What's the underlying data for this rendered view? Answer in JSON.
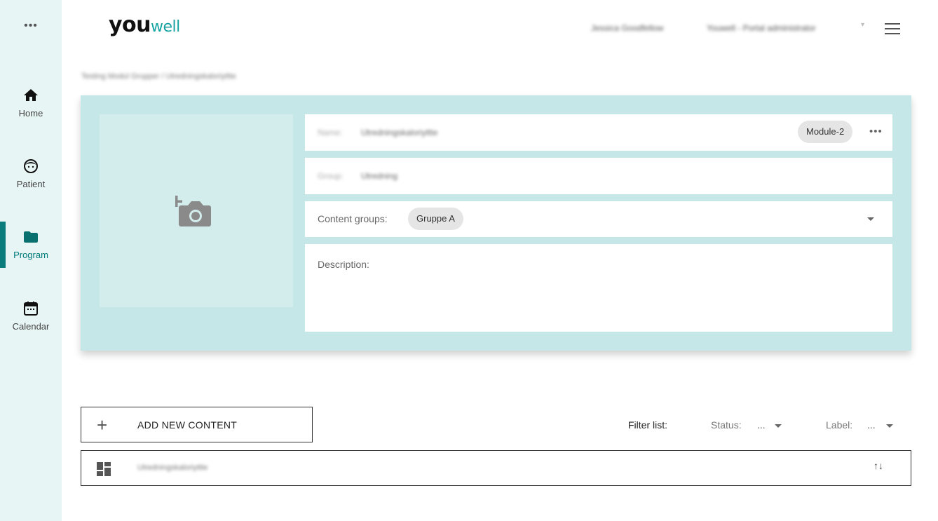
{
  "sidebar": {
    "more_label": "•••",
    "items": [
      {
        "label": "Home",
        "icon": "home-icon"
      },
      {
        "label": "Patient",
        "icon": "face-icon"
      },
      {
        "label": "Program",
        "icon": "folder-icon",
        "active": true
      },
      {
        "label": "Calendar",
        "icon": "calendar-icon"
      }
    ]
  },
  "header": {
    "logo_prefix": "you",
    "logo_suffix": "well",
    "user_name": "Jessica Goodfellow",
    "user_role": "Youwell - Portal administrator",
    "role_caret": "▾",
    "menu_icon": "hamburger-icon"
  },
  "breadcrumb": "Testing Modul Grupper / Utredningskaloriyttte",
  "module": {
    "name_label": "Name:",
    "name_value": "Utredningskaloriyttte",
    "module_chip": "Module-2",
    "more_icon": "•••",
    "group_label": "Group:",
    "group_value": "Utredning",
    "content_groups_label": "Content groups:",
    "content_group_chip": "Gruppe A",
    "description_label": "Description:"
  },
  "controls": {
    "add_plus": "+",
    "add_label": "ADD NEW CONTENT",
    "filter_label": "Filter list:",
    "status_label": "Status:",
    "status_value": "...",
    "label_label": "Label:",
    "label_value": "..."
  },
  "content_list": [
    {
      "title": "Utredningskaloriyttte",
      "sort_icon": "↑↓"
    }
  ],
  "colors": {
    "accent": "#0a7c7c",
    "sidebar_bg": "#e8f5f5",
    "panel_bg": "#c6e7e7",
    "logo_teal": "#18a3a3"
  }
}
